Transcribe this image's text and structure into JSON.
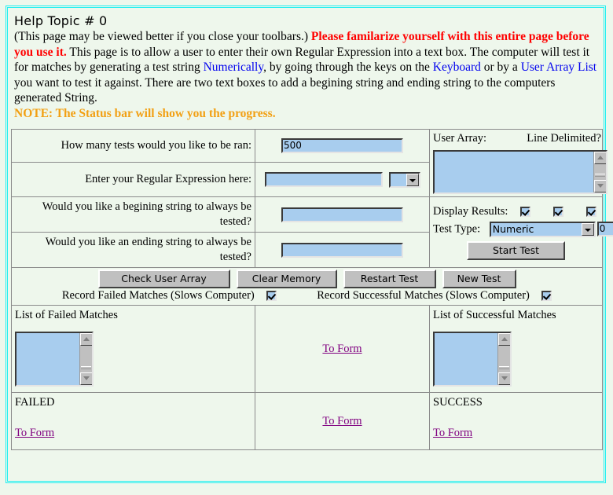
{
  "page": {
    "title": "Help Topic # 0",
    "intro_parts": {
      "p1": "(This page may be viewed better if you close your toolbars.) ",
      "warn": "Please familarize yourself with this entire page before you use it.",
      "p2": " This page is to allow a user to enter their own Regular Expression into a text box. The computer will test it for matches by generating a test string ",
      "link_numerically": "Numerically",
      "p3": ", by going through the keys on the ",
      "link_keyboard": "Keyboard",
      "p4": " or by a ",
      "link_userarraylist": "User Array List",
      "p5": " you want to test it against. There are two text boxes to add a begining string and ending string to the computers generated String.",
      "note": "NOTE: The Status bar will show you the progress."
    }
  },
  "form": {
    "tests_label": "How many tests would you like to be ran:",
    "tests_value": "500",
    "regex_label": "Enter your Regular Expression here:",
    "regex_value": "",
    "regex_select_value": "",
    "begin_label": "Would you like a begining string to always be tested?",
    "begin_value": "",
    "end_label": "Would you like an ending string to always be tested?",
    "end_value": "",
    "user_array_label": "User Array:",
    "line_delimited_label": "Line Delimited?",
    "user_array_value": "",
    "display_results_label": "Display Results:",
    "test_type_label": "Test Type:",
    "test_type_value": "Numeric",
    "test_counter_value": "0",
    "start_test_label": "Start Test"
  },
  "buttons": {
    "check_user_array": "Check User Array",
    "clear_memory": "Clear Memory",
    "restart_test": "Restart Test",
    "new_test": "New Test"
  },
  "record": {
    "failed_label": "Record Failed Matches (Slows Computer)",
    "success_label": "Record Successful Matches (Slows Computer)"
  },
  "results": {
    "failed_list_label": "List of Failed Matches",
    "failed_list_value": "",
    "success_list_label": "List of Successful Matches",
    "success_list_value": "",
    "failed_status": "FAILED",
    "success_status": "SUCCESS",
    "to_form_1": "To Form",
    "to_form_2": "To Form",
    "to_form_3": "To Form",
    "to_form_4": "To Form"
  },
  "colors": {
    "border": "#22f0f0",
    "background": "#eef7ec",
    "input_bg": "#a8cdee",
    "warning": "#ff0000",
    "link": "#0000ee",
    "note": "#f2a014",
    "visited_link": "#800080",
    "button_face": "#c0c0c0",
    "cell_border": "#8b8b8b"
  }
}
